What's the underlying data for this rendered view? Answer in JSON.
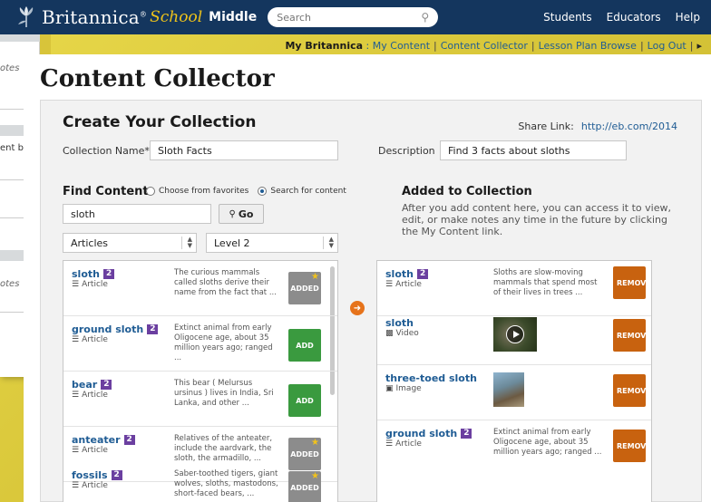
{
  "background_window": {
    "fragments": [
      "otes",
      "ent b",
      "otes"
    ]
  },
  "nav": {
    "logo_brand": "Britannica",
    "logo_reg": "®",
    "logo_school": "School",
    "logo_level": "Middle",
    "search_placeholder": "Search",
    "links": [
      "Students",
      "Educators",
      "Help"
    ]
  },
  "sub_links": {
    "my_britannica": "My Britannica",
    "colon": " : ",
    "items": [
      "My Content",
      "Content Collector",
      "Lesson Plan Browse",
      "Log Out"
    ],
    "more": "▸"
  },
  "page_title": "Content Collector",
  "create": {
    "title": "Create Your Collection",
    "share_label": "Share Link:",
    "share_url": "http://eb.com/2014",
    "name_label": "Collection Name*",
    "name_value": "Sloth Facts",
    "desc_label": "Description",
    "desc_value": "Find 3 facts about sloths"
  },
  "find": {
    "title": "Find Content",
    "option_favorites": "Choose from favorites",
    "option_search": "Search for content",
    "search_value": "sloth",
    "go_label": "Go",
    "type_select": "Articles",
    "level_select": "Level 2",
    "results": [
      {
        "title": "sloth",
        "level": "2",
        "type": "Article",
        "desc": "The curious mammals called sloths derive their name from the fact that ...",
        "action": "ADDED"
      },
      {
        "title": "ground sloth",
        "level": "2",
        "type": "Article",
        "desc": "Extinct animal from early Oligocene age, about 35 million years ago; ranged ...",
        "action": "ADD"
      },
      {
        "title": "bear",
        "level": "2",
        "type": "Article",
        "desc": "This bear ( Melursus ursinus ) lives in India, Sri Lanka, and other ...",
        "action": "ADD"
      },
      {
        "title": "anteater",
        "level": "2",
        "type": "Article",
        "desc": "Relatives of the anteater, include the aardvark, the sloth, the armadillo, ...",
        "action": "ADDED"
      },
      {
        "title": "fossils",
        "level": "2",
        "type": "Article",
        "desc": "Saber-toothed tigers, giant wolves, sloths, mastodons, short-faced bears, ...",
        "action": "ADDED"
      }
    ]
  },
  "added": {
    "title": "Added to Collection",
    "desc": "After you add content here, you can access it to view, edit, or make notes any time in the future by clicking the My Content link.",
    "remove_label": "REMOVE",
    "items": [
      {
        "title": "sloth",
        "level": "2",
        "type": "Article",
        "desc": "Sloths are slow-moving mammals that spend most of their lives in trees ..."
      },
      {
        "title": "sloth",
        "level": "",
        "type": "Video",
        "desc": ""
      },
      {
        "title": "three-toed sloth",
        "level": "",
        "type": "Image",
        "desc": ""
      },
      {
        "title": "ground sloth",
        "level": "2",
        "type": "Article",
        "desc": "Extinct animal from early Oligocene age, about 35 million years ago; ranged ..."
      }
    ]
  },
  "colors": {
    "nav_bg": "#14365e",
    "link": "#1f5c94",
    "add_green": "#3a9a3f",
    "added_gray": "#8c8c8c",
    "remove_orange": "#c8620f",
    "level_badge": "#6b3fa0"
  }
}
